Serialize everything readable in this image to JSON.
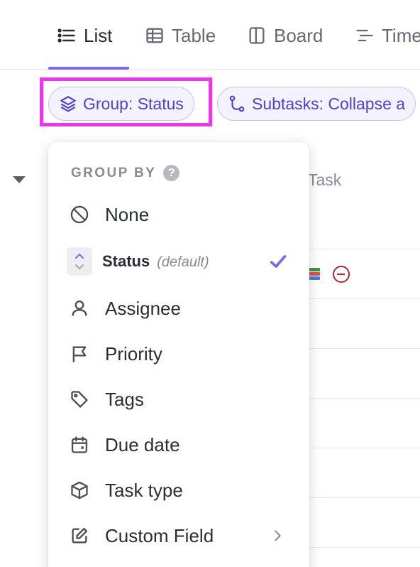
{
  "tabs": [
    {
      "label": "List",
      "icon": "list-icon",
      "active": true
    },
    {
      "label": "Table",
      "icon": "table-icon",
      "active": false
    },
    {
      "label": "Board",
      "icon": "board-icon",
      "active": false
    },
    {
      "label": "Time",
      "icon": "timeline-icon",
      "active": false
    }
  ],
  "toolbar": {
    "group_chip": "Group: Status",
    "subtasks_chip": "Subtasks: Collapse a"
  },
  "background": {
    "column_header": "Task"
  },
  "dropdown": {
    "heading": "GROUP BY",
    "help": "?",
    "options": [
      {
        "label": "None",
        "icon": "none-icon"
      },
      {
        "label": "Status",
        "note": "(default)",
        "icon": "status-icon",
        "selected": true
      },
      {
        "label": "Assignee",
        "icon": "person-icon"
      },
      {
        "label": "Priority",
        "icon": "flag-icon"
      },
      {
        "label": "Tags",
        "icon": "tag-icon"
      },
      {
        "label": "Due date",
        "icon": "calendar-icon"
      },
      {
        "label": "Task type",
        "icon": "cube-icon"
      },
      {
        "label": "Custom Field",
        "icon": "edit-icon",
        "has_submenu": true
      }
    ]
  },
  "colors": {
    "accent": "#7b68ee",
    "highlight": "#e63ae6",
    "chip_text": "#4f43c9",
    "danger": "#b3262d"
  }
}
